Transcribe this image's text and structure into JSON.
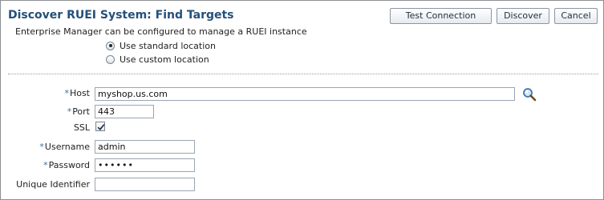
{
  "header": {
    "title": "Discover RUEI System: Find Targets",
    "subtitle": "Enterprise Manager can be configured to manage a RUEI instance"
  },
  "buttons": {
    "test_connection": "Test Connection",
    "discover": "Discover",
    "cancel": "Cancel"
  },
  "location_options": [
    {
      "label": "Use standard location",
      "selected": true
    },
    {
      "label": "Use custom location",
      "selected": false
    }
  ],
  "form": {
    "required_marker": "*",
    "host": {
      "label": "Host",
      "value": "myshop.us.com",
      "required": true
    },
    "port": {
      "label": "Port",
      "value": "443",
      "required": true
    },
    "ssl": {
      "label": "SSL",
      "checked": true
    },
    "username": {
      "label": "Username",
      "value": "admin",
      "required": true
    },
    "password": {
      "label": "Password",
      "value": "••••••",
      "required": true
    },
    "unique_identifier": {
      "label": "Unique Identifier",
      "value": ""
    }
  },
  "colors": {
    "title": "#24507a",
    "required_marker": "#3d6e9c",
    "search_icon": "#3b78b8"
  }
}
